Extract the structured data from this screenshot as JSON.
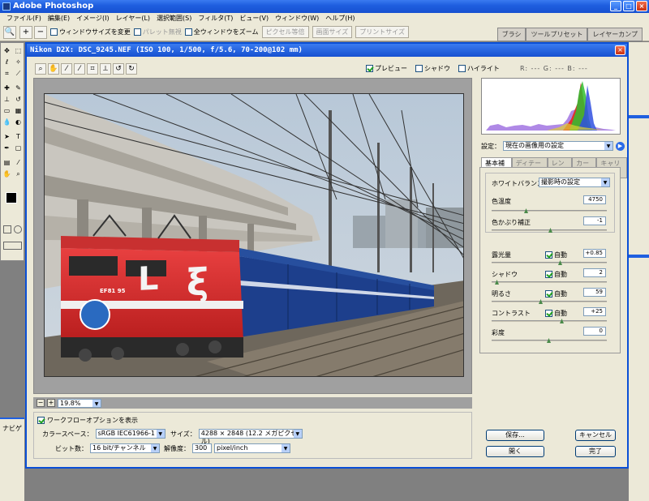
{
  "app": {
    "title": "Adobe Photoshop",
    "win_buttons": [
      "_",
      "□",
      "×"
    ]
  },
  "menu": [
    "ファイル(F)",
    "編集(E)",
    "イメージ(I)",
    "レイヤー(L)",
    "選択範囲(S)",
    "フィルタ(T)",
    "ビュー(V)",
    "ウィンドウ(W)",
    "ヘルプ(H)"
  ],
  "options_bar": {
    "zoom_icon": "🔍",
    "resize_window": "ウィンドウサイズを変更",
    "ignore_palettes": "パレット無視",
    "zoom_all": "全ウィンドウをズーム",
    "actual_pixels": "ピクセル等倍",
    "fit_screen": "画面サイズ",
    "print_size": "プリントサイズ"
  },
  "palette_tabs": [
    "ブラシ",
    "ツールプリセット",
    "レイヤーカンプ"
  ],
  "dialog": {
    "title": "Nikon D2X:  DSC_9245.NEF  (ISO 100, 1/500, f/5.6, 70-200@102 mm)",
    "preview_label": "プレビュー",
    "shadows_label": "シャドウ",
    "highlights_label": "ハイライト",
    "rgb_readout": "R: ---   G: ---   B: ---",
    "zoom_value": "19.8%",
    "workflow": {
      "show_label": "ワークフローオプションを表示",
      "colorspace_label": "カラースペース：",
      "colorspace_value": "sRGB IEC61966-1",
      "size_label": "サイズ：",
      "size_value": "4288 × 2848 (12.2 メガピクセル)",
      "bitdepth_label": "ビット数：",
      "bitdepth_value": "16 bit/チャンネル",
      "resolution_label": "解像度：",
      "resolution_value": "300",
      "resolution_unit": "pixel/inch"
    },
    "buttons": {
      "save": "保存...",
      "open": "開く",
      "cancel": "キャンセル",
      "done": "完了"
    },
    "settings": {
      "label": "設定：",
      "value": "現在の画像用の設定"
    },
    "tabs": [
      "基本補正",
      "ディテール",
      "レンズ",
      "カーブ",
      "キャリブ"
    ],
    "white_balance": {
      "label": "ホワイトバランス：",
      "value": "撮影時の設定"
    },
    "params": {
      "temperature": {
        "label": "色温度",
        "value": "4750"
      },
      "tint": {
        "label": "色かぶり補正",
        "value": "-1"
      },
      "exposure": {
        "label": "露光量",
        "auto": "自動",
        "value": "+0.85"
      },
      "shadows": {
        "label": "シャドウ",
        "auto": "自動",
        "value": "2"
      },
      "brightness": {
        "label": "明るさ",
        "auto": "自動",
        "value": "59"
      },
      "contrast": {
        "label": "コントラスト",
        "auto": "自動",
        "value": "+25"
      },
      "saturation": {
        "label": "彩度",
        "value": "0"
      }
    },
    "photo": {
      "loco_number": "EF81 95"
    }
  },
  "side_panel_label": "ナビゲ"
}
